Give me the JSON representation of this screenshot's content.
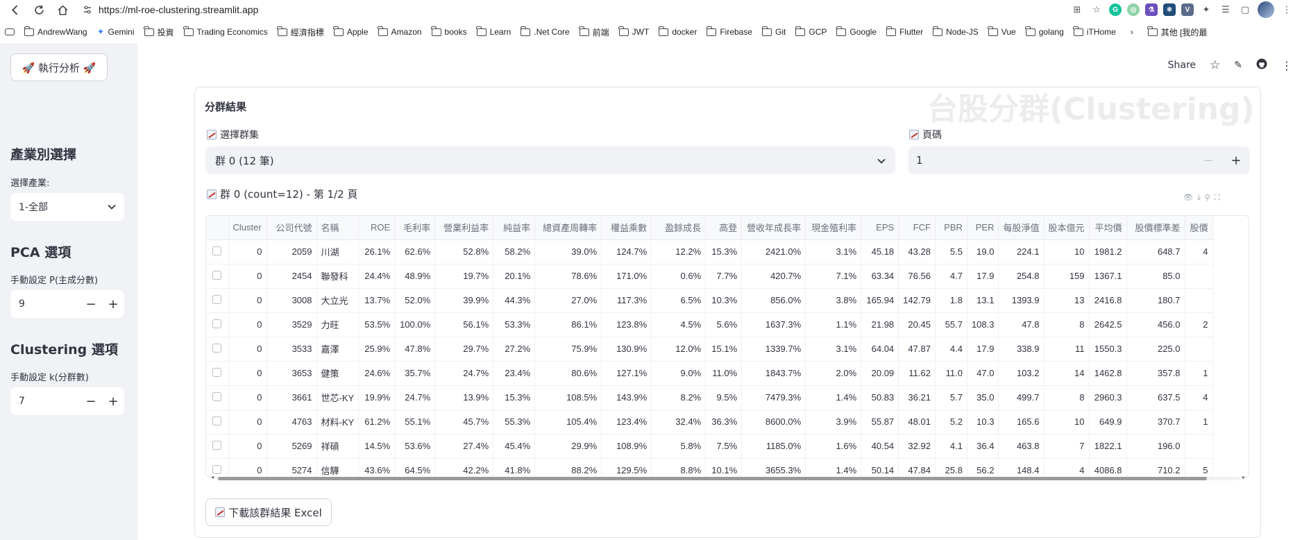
{
  "browser": {
    "url": "https://ml-roe-clustering.streamlit.app",
    "bookmarks": [
      "AndrewWang",
      "Gemini",
      "投資",
      "Trading Economics",
      "經濟指標",
      "Apple",
      "Amazon",
      "books",
      "Learn",
      ".Net Core",
      "前端",
      "JWT",
      "docker",
      "Firebase",
      "Git",
      "GCP",
      "Google",
      "Flutter",
      "Node-JS",
      "Vue",
      "golang",
      "iTHome"
    ],
    "other_bookmarks": "其他 [我的最"
  },
  "header": {
    "share": "Share",
    "watermark": "台股分群(Clustering)"
  },
  "sidebar": {
    "run_button": "🚀 執行分析 🚀",
    "industry_title": "產業別選擇",
    "industry_label": "選擇產業:",
    "industry_value": "1-全部",
    "pca_title": "PCA 選項",
    "pca_label": "手動設定 P(主成分數)",
    "pca_value": "9",
    "cluster_title": "Clustering 選項",
    "cluster_label": "手動設定 k(分群數)",
    "cluster_value": "7"
  },
  "main": {
    "section_title": "分群結果",
    "select_cluster_label": "選擇群集",
    "select_cluster_value": "群 0 (12 筆)",
    "page_label": "頁碼",
    "page_value": "1",
    "table_title": "群 0 (count=12) - 第 1/2 頁",
    "download_button": "下載該群結果 Excel"
  },
  "table": {
    "columns": [
      "Cluster",
      "公司代號",
      "名稱",
      "ROE",
      "毛利率",
      "營業利益率",
      "純益率",
      "總資產周轉率",
      "權益乘數",
      "盈餘成長",
      "高登",
      "營收年成長率",
      "現金殖利率",
      "EPS",
      "FCF",
      "PBR",
      "PER",
      "每股淨值",
      "股本億元",
      "平均價",
      "股價標準差",
      "股價"
    ],
    "rows": [
      [
        "0",
        "2059",
        "川湖",
        "26.1%",
        "62.6%",
        "52.8%",
        "58.2%",
        "39.0%",
        "124.7%",
        "12.2%",
        "15.3%",
        "2421.0%",
        "3.1%",
        "45.18",
        "43.28",
        "5.5",
        "19.0",
        "224.1",
        "10",
        "1981.2",
        "648.7",
        "4"
      ],
      [
        "0",
        "2454",
        "聯發科",
        "24.4%",
        "48.9%",
        "19.7%",
        "20.1%",
        "78.6%",
        "171.0%",
        "0.6%",
        "7.7%",
        "420.7%",
        "7.1%",
        "63.34",
        "76.56",
        "4.7",
        "17.9",
        "254.8",
        "159",
        "1367.1",
        "85.0",
        ""
      ],
      [
        "0",
        "3008",
        "大立光",
        "13.7%",
        "52.0%",
        "39.9%",
        "44.3%",
        "27.0%",
        "117.3%",
        "6.5%",
        "10.3%",
        "856.0%",
        "3.8%",
        "165.94",
        "142.79",
        "1.8",
        "13.1",
        "1393.9",
        "13",
        "2416.8",
        "180.7",
        ""
      ],
      [
        "0",
        "3529",
        "力旺",
        "53.5%",
        "100.0%",
        "56.1%",
        "53.3%",
        "86.1%",
        "123.8%",
        "4.5%",
        "5.6%",
        "1637.3%",
        "1.1%",
        "21.98",
        "20.45",
        "55.7",
        "108.3",
        "47.8",
        "8",
        "2642.5",
        "456.0",
        "2"
      ],
      [
        "0",
        "3533",
        "嘉澤",
        "25.9%",
        "47.8%",
        "29.7%",
        "27.2%",
        "75.9%",
        "130.9%",
        "12.0%",
        "15.1%",
        "1339.7%",
        "3.1%",
        "64.04",
        "47.87",
        "4.4",
        "17.9",
        "338.9",
        "11",
        "1550.3",
        "225.0",
        ""
      ],
      [
        "0",
        "3653",
        "健策",
        "24.6%",
        "35.7%",
        "24.7%",
        "23.4%",
        "80.6%",
        "127.1%",
        "9.0%",
        "11.0%",
        "1843.7%",
        "2.0%",
        "20.09",
        "11.62",
        "11.0",
        "47.0",
        "103.2",
        "14",
        "1462.8",
        "357.8",
        "1"
      ],
      [
        "0",
        "3661",
        "世芯-KY",
        "19.9%",
        "24.7%",
        "13.9%",
        "15.3%",
        "108.5%",
        "143.9%",
        "8.2%",
        "9.5%",
        "7479.3%",
        "1.4%",
        "50.83",
        "36.21",
        "5.7",
        "35.0",
        "499.7",
        "8",
        "2960.3",
        "637.5",
        "4"
      ],
      [
        "0",
        "4763",
        "材料-KY",
        "61.2%",
        "55.1%",
        "45.7%",
        "55.3%",
        "105.4%",
        "123.4%",
        "32.4%",
        "36.3%",
        "8600.0%",
        "3.9%",
        "55.87",
        "48.01",
        "5.2",
        "10.3",
        "165.6",
        "10",
        "649.9",
        "370.7",
        "1"
      ],
      [
        "0",
        "5269",
        "祥碩",
        "14.5%",
        "53.6%",
        "27.4%",
        "45.4%",
        "29.9%",
        "108.9%",
        "5.8%",
        "7.5%",
        "1185.0%",
        "1.6%",
        "40.54",
        "32.92",
        "4.1",
        "36.4",
        "463.8",
        "7",
        "1822.1",
        "196.0",
        ""
      ],
      [
        "0",
        "5274",
        "信驊",
        "43.6%",
        "64.5%",
        "42.2%",
        "41.8%",
        "88.2%",
        "129.5%",
        "8.8%",
        "10.1%",
        "3655.3%",
        "1.4%",
        "50.14",
        "47.84",
        "25.8",
        "56.2",
        "148.4",
        "4",
        "4086.8",
        "710.2",
        "5"
      ]
    ]
  }
}
